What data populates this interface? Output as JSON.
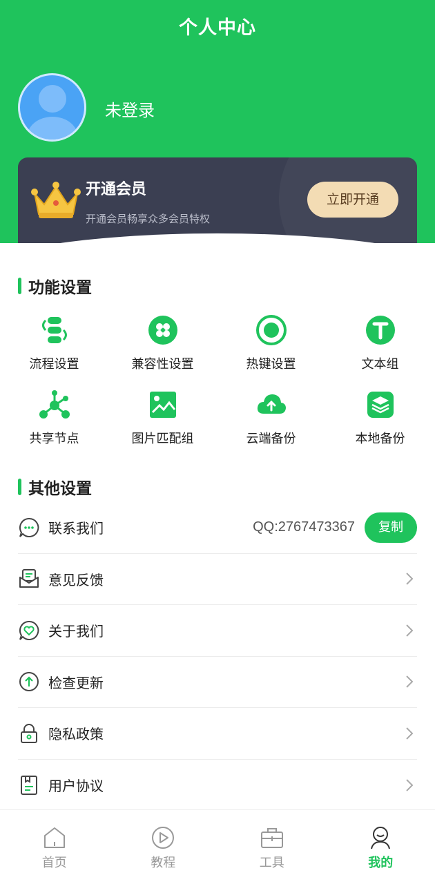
{
  "header": {
    "title": "个人中心",
    "login_status": "未登录"
  },
  "vip": {
    "title": "开通会员",
    "subtitle": "开通会员畅享众多会员特权",
    "button": "立即开通"
  },
  "function_settings": {
    "title": "功能设置",
    "items": [
      {
        "label": "流程设置",
        "icon": "process-icon"
      },
      {
        "label": "兼容性设置",
        "icon": "compatibility-icon"
      },
      {
        "label": "热键设置",
        "icon": "hotkey-icon"
      },
      {
        "label": "文本组",
        "icon": "text-group-icon"
      },
      {
        "label": "共享节点",
        "icon": "share-node-icon"
      },
      {
        "label": "图片匹配组",
        "icon": "image-match-icon"
      },
      {
        "label": "云端备份",
        "icon": "cloud-backup-icon"
      },
      {
        "label": "本地备份",
        "icon": "local-backup-icon"
      }
    ]
  },
  "other_settings": {
    "title": "其他设置",
    "contact": {
      "label": "联系我们",
      "qq": "QQ:2767473367",
      "copy": "复制"
    },
    "rows": [
      {
        "label": "意见反馈",
        "icon": "feedback-icon"
      },
      {
        "label": "关于我们",
        "icon": "about-icon"
      },
      {
        "label": "检查更新",
        "icon": "update-icon"
      },
      {
        "label": "隐私政策",
        "icon": "privacy-icon"
      },
      {
        "label": "用户协议",
        "icon": "agreement-icon"
      }
    ]
  },
  "tabbar": {
    "items": [
      {
        "label": "首页",
        "icon": "home-icon"
      },
      {
        "label": "教程",
        "icon": "tutorial-icon"
      },
      {
        "label": "工具",
        "icon": "toolbox-icon"
      },
      {
        "label": "我的",
        "icon": "profile-icon"
      }
    ],
    "active": "我的"
  },
  "colors": {
    "brand": "#1fc35c",
    "vip_card": "#3b3f52",
    "vip_button": "#f3dcb4"
  }
}
